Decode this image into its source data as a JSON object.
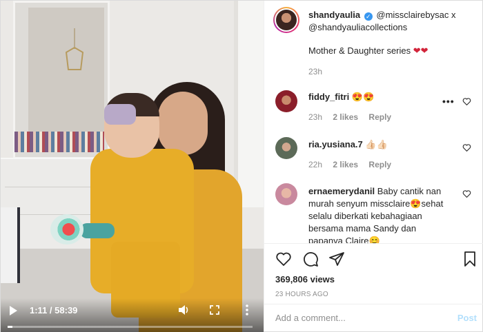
{
  "video": {
    "current_time": "1:11",
    "separator": " / ",
    "duration": "58:39",
    "progress_fraction": 0.02
  },
  "caption": {
    "username": "shandyaulia",
    "mention_line1": "@missclairebysac x",
    "mention_line2": "@shandyauliacollections",
    "text": "Mother & Daughter series",
    "hearts": "❤❤",
    "time": "23h"
  },
  "comments": [
    {
      "username": "fiddy_fitri",
      "text": "😍😍",
      "time": "23h",
      "likes": "2 likes",
      "reply": "Reply"
    },
    {
      "username": "ria.yusiana.7",
      "text": "👍🏻👍🏻",
      "time": "22h",
      "likes": "2 likes",
      "reply": "Reply"
    },
    {
      "username": "ernaemerydanil",
      "text": "Baby cantik nan murah senyum missclaire😍sehat selalu diberkati kebahagiaan bersama mama Sandy dan papanya Claire😊",
      "line1": "Baby cantik nan",
      "line2": "murah senyum missclaire😍sehat",
      "line3": "selalu diberkati kebahagiaan",
      "line4": "bersama mama Sandy dan",
      "line5": "papanya Claire😊"
    }
  ],
  "more_options": "•••",
  "stats": {
    "views": "369,806 views",
    "date": "23 HOURS AGO"
  },
  "comment_box": {
    "placeholder": "Add a comment...",
    "post_label": "Post"
  },
  "colors": {
    "link": "#262626",
    "meta": "#8e8e8e",
    "post_disabled": "#b2dffc",
    "verified": "#3897f0"
  }
}
